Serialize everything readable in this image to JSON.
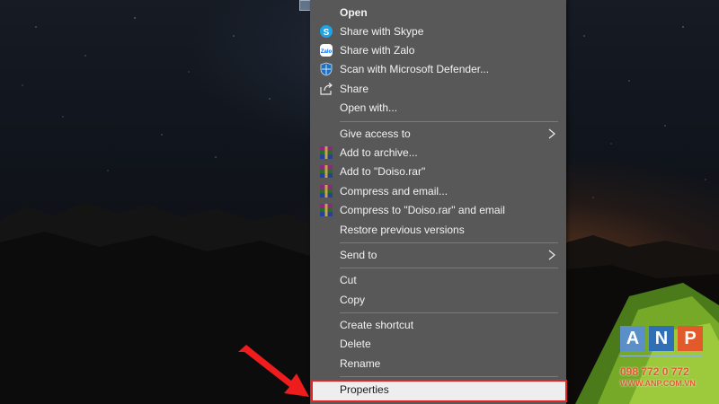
{
  "context_menu": {
    "items": [
      {
        "label": "Open",
        "icon": "",
        "bold": true,
        "submenu": false
      },
      {
        "label": "Share with Skype",
        "icon": "skype-icon",
        "submenu": false
      },
      {
        "label": "Share with Zalo",
        "icon": "zalo-icon",
        "submenu": false
      },
      {
        "label": "Scan with Microsoft Defender...",
        "icon": "defender-icon",
        "submenu": false
      },
      {
        "label": "Share",
        "icon": "share-icon",
        "submenu": false
      },
      {
        "label": "Open with...",
        "icon": "",
        "submenu": false
      },
      {
        "label": "Give access to",
        "icon": "",
        "submenu": true
      },
      {
        "label": "Add to archive...",
        "icon": "winrar-icon",
        "submenu": false
      },
      {
        "label": "Add to \"Doiso.rar\"",
        "icon": "winrar-icon",
        "submenu": false
      },
      {
        "label": "Compress and email...",
        "icon": "winrar-icon",
        "submenu": false
      },
      {
        "label": "Compress to \"Doiso.rar\" and email",
        "icon": "winrar-icon",
        "submenu": false
      },
      {
        "label": "Restore previous versions",
        "icon": "",
        "submenu": false
      },
      {
        "label": "Send to",
        "icon": "",
        "submenu": true
      },
      {
        "label": "Cut",
        "icon": "",
        "submenu": false
      },
      {
        "label": "Copy",
        "icon": "",
        "submenu": false
      },
      {
        "label": "Create shortcut",
        "icon": "",
        "submenu": false
      },
      {
        "label": "Delete",
        "icon": "",
        "submenu": false
      },
      {
        "label": "Rename",
        "icon": "",
        "submenu": false
      },
      {
        "label": "Properties",
        "icon": "",
        "submenu": false,
        "highlighted": true
      }
    ]
  },
  "annotation": {
    "arrow_icon": "red-arrow-icon",
    "highlight_color": "#e22424"
  },
  "watermark": {
    "letters": [
      "A",
      "N",
      "P"
    ],
    "letter_colors": [
      "#5a8fc7",
      "#2f6fb6",
      "#e25a2c"
    ],
    "phone": "098 772 0 772",
    "site": "WWW.ANP.COM.VN"
  },
  "colors": {
    "menu_bg": "#585858",
    "menu_text": "#f2f2f2",
    "separator": "#7a7a7a",
    "highlight_border": "#e22424"
  }
}
